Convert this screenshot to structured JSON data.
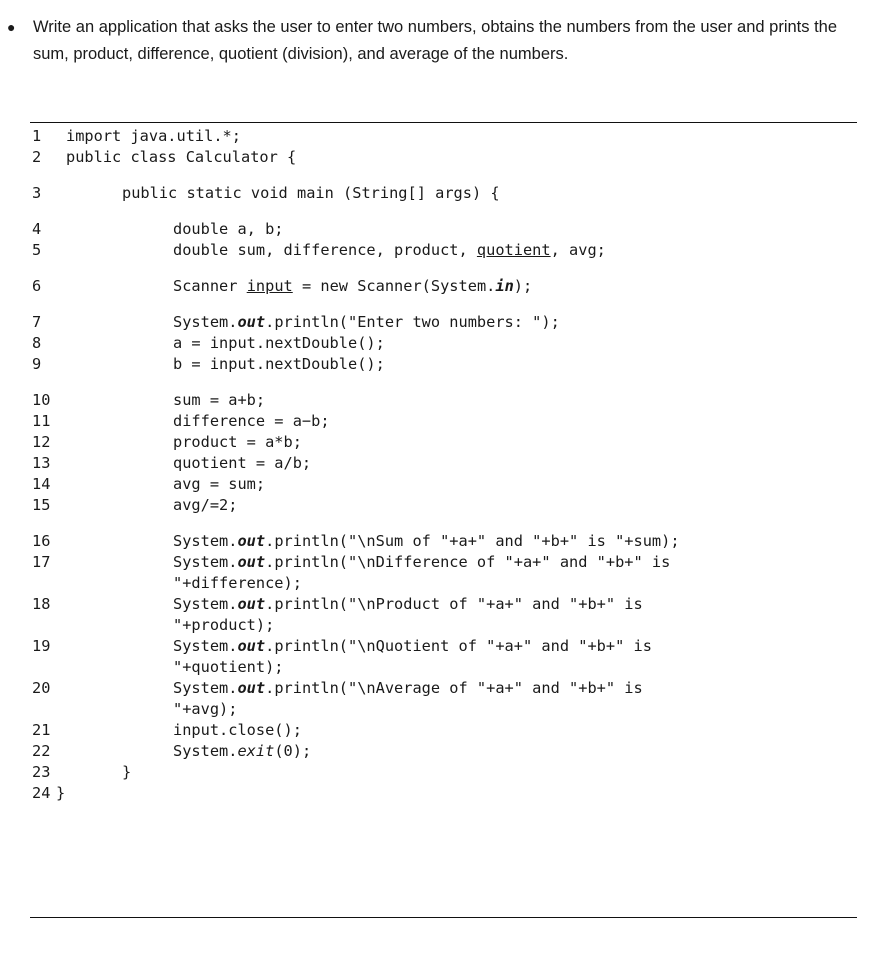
{
  "task": {
    "bullet": "●",
    "text": "Write an application that asks the user to enter two numbers, obtains the numbers from the user and prints the sum, product, difference, quotient (division), and average of the numbers."
  },
  "code": {
    "language": "java",
    "lines": [
      {
        "num": "1",
        "segments": [
          {
            "t": "import java.util.*;"
          }
        ]
      },
      {
        "num": "2",
        "segments": [
          {
            "t": "public class Calculator {"
          }
        ]
      },
      {
        "num": "3",
        "segments": [
          {
            "t": "public static void main (String[] args) {"
          }
        ]
      },
      {
        "num": "4",
        "segments": [
          {
            "t": "double a, b;"
          }
        ]
      },
      {
        "num": "5",
        "segments": [
          {
            "t": "double sum, difference, product, "
          },
          {
            "t": "quotient",
            "style": "u"
          },
          {
            "t": ", avg;"
          }
        ]
      },
      {
        "num": "6",
        "segments": [
          {
            "t": "Scanner "
          },
          {
            "t": "input",
            "style": "u"
          },
          {
            "t": " = new Scanner(System."
          },
          {
            "t": "in",
            "style": "bi"
          },
          {
            "t": ");"
          }
        ]
      },
      {
        "num": "7",
        "segments": [
          {
            "t": "System."
          },
          {
            "t": "out",
            "style": "bi"
          },
          {
            "t": ".println(\"Enter two numbers: \");"
          }
        ]
      },
      {
        "num": "8",
        "segments": [
          {
            "t": "a = input.nextDouble();"
          }
        ]
      },
      {
        "num": "9",
        "segments": [
          {
            "t": "b = input.nextDouble();"
          }
        ]
      },
      {
        "num": "10",
        "segments": [
          {
            "t": "sum = a+b;"
          }
        ]
      },
      {
        "num": "11",
        "segments": [
          {
            "t": "difference = a−b;"
          }
        ]
      },
      {
        "num": "12",
        "segments": [
          {
            "t": "product = a*b;"
          }
        ]
      },
      {
        "num": "13",
        "segments": [
          {
            "t": "quotient = a/b;"
          }
        ]
      },
      {
        "num": "14",
        "segments": [
          {
            "t": "avg = sum;"
          }
        ]
      },
      {
        "num": "15",
        "segments": [
          {
            "t": "avg/=2;"
          }
        ]
      },
      {
        "num": "16",
        "segments": [
          {
            "t": "System."
          },
          {
            "t": "out",
            "style": "bi"
          },
          {
            "t": ".println(\"\\nSum of \"+a+\" and \"+b+\" is \"+sum);"
          }
        ]
      },
      {
        "num": "17",
        "segments": [
          {
            "t": "System."
          },
          {
            "t": "out",
            "style": "bi"
          },
          {
            "t": ".println(\"\\nDifference of \"+a+\" and \"+b+\" is"
          }
        ],
        "continuation": "\"+difference);"
      },
      {
        "num": "18",
        "segments": [
          {
            "t": "System."
          },
          {
            "t": "out",
            "style": "bi"
          },
          {
            "t": ".println(\"\\nProduct of \"+a+\" and \"+b+\" is"
          }
        ],
        "continuation": "\"+product);"
      },
      {
        "num": "19",
        "segments": [
          {
            "t": "System."
          },
          {
            "t": "out",
            "style": "bi"
          },
          {
            "t": ".println(\"\\nQuotient of \"+a+\" and \"+b+\" is"
          }
        ],
        "continuation": "\"+quotient);"
      },
      {
        "num": "20",
        "segments": [
          {
            "t": "System."
          },
          {
            "t": "out",
            "style": "bi"
          },
          {
            "t": ".println(\"\\nAverage of \"+a+\" and \"+b+\" is"
          }
        ],
        "continuation": "\"+avg);"
      },
      {
        "num": "21",
        "segments": [
          {
            "t": "input.close();"
          }
        ]
      },
      {
        "num": "22",
        "segments": [
          {
            "t": "System."
          },
          {
            "t": "exit",
            "style": "i"
          },
          {
            "t": "(0);"
          }
        ]
      },
      {
        "num": "23",
        "segments": [
          {
            "t": "}"
          }
        ]
      },
      {
        "num": "24",
        "segments": [
          {
            "t": "}"
          }
        ]
      }
    ]
  }
}
